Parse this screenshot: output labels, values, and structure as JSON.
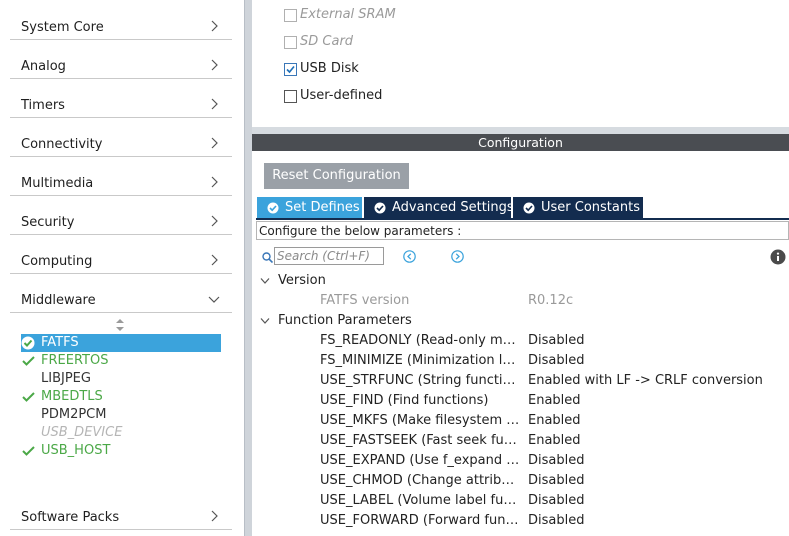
{
  "sidebar": {
    "categories": [
      {
        "label": "System Core",
        "expanded": false
      },
      {
        "label": "Analog",
        "expanded": false
      },
      {
        "label": "Timers",
        "expanded": false
      },
      {
        "label": "Connectivity",
        "expanded": false
      },
      {
        "label": "Multimedia",
        "expanded": false
      },
      {
        "label": "Security",
        "expanded": false
      },
      {
        "label": "Computing",
        "expanded": false
      },
      {
        "label": "Middleware",
        "expanded": true
      },
      {
        "label": "Software Packs",
        "expanded": false
      }
    ],
    "middleware_items": [
      {
        "label": "FATFS",
        "state": "selected-enabled"
      },
      {
        "label": "FREERTOS",
        "state": "enabled"
      },
      {
        "label": "LIBJPEG",
        "state": "available"
      },
      {
        "label": "MBEDTLS",
        "state": "enabled"
      },
      {
        "label": "PDM2PCM",
        "state": "available"
      },
      {
        "label": "USB_DEVICE",
        "state": "disabled"
      },
      {
        "label": "USB_HOST",
        "state": "enabled"
      }
    ]
  },
  "mode": {
    "options": [
      {
        "label": "External SRAM",
        "checked": false,
        "disabled": true
      },
      {
        "label": "SD Card",
        "checked": false,
        "disabled": true
      },
      {
        "label": "USB Disk",
        "checked": true,
        "disabled": false
      },
      {
        "label": "User-defined",
        "checked": false,
        "disabled": false
      }
    ]
  },
  "config": {
    "title": "Configuration",
    "reset_label": "Reset Configuration",
    "tabs": [
      {
        "label": "Set Defines",
        "active": true
      },
      {
        "label": "Advanced Settings",
        "active": false
      },
      {
        "label": "User Constants",
        "active": false
      }
    ],
    "hint": "Configure the below parameters :",
    "search_placeholder": "Search (Ctrl+F)",
    "groups": [
      {
        "label": "Version",
        "params": [
          {
            "name": "FATFS version",
            "value": "R0.12c",
            "readonly": true
          }
        ]
      },
      {
        "label": "Function Parameters",
        "params": [
          {
            "name": "FS_READONLY (Read-only mode)",
            "value": "Disabled"
          },
          {
            "name": "FS_MINIMIZE (Minimization level)",
            "value": "Disabled"
          },
          {
            "name": "USE_STRFUNC (String functions)",
            "value": "Enabled with LF -> CRLF conversion"
          },
          {
            "name": "USE_FIND (Find functions)",
            "value": "Enabled"
          },
          {
            "name": "USE_MKFS (Make filesystem function)",
            "value": "Enabled"
          },
          {
            "name": "USE_FASTSEEK (Fast seek function)",
            "value": "Enabled"
          },
          {
            "name": "USE_EXPAND (Use f_expand function)",
            "value": "Disabled"
          },
          {
            "name": "USE_CHMOD (Change attributes function)",
            "value": "Disabled"
          },
          {
            "name": "USE_LABEL (Volume label functions)",
            "value": "Disabled"
          },
          {
            "name": "USE_FORWARD (Forward function)",
            "value": "Disabled"
          }
        ]
      }
    ]
  },
  "colors": {
    "accent_blue": "#3ba3dc",
    "tab_dark": "#132c4f",
    "enabled_green": "#4ba847"
  }
}
